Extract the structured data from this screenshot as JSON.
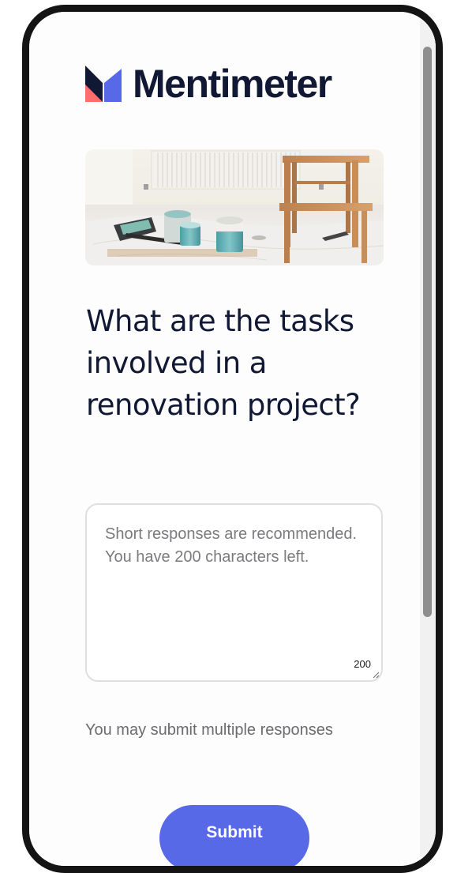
{
  "brand": {
    "name": "Mentimeter",
    "colors": {
      "navy": "#101834",
      "coral": "#ff6d6d",
      "blue": "#5769e7"
    }
  },
  "hero_image": {
    "icon": "renovation-photo"
  },
  "question": {
    "text": "What are the tasks involved in a renovation project?"
  },
  "answer": {
    "value": "",
    "placeholder": "Short responses are recommended. You have 200 characters left.",
    "char_count": "200"
  },
  "hint": {
    "text": "You may submit multiple responses"
  },
  "submit": {
    "label": "Submit",
    "color": "#5769e7"
  },
  "scrollbar": {
    "position": 0.0
  }
}
